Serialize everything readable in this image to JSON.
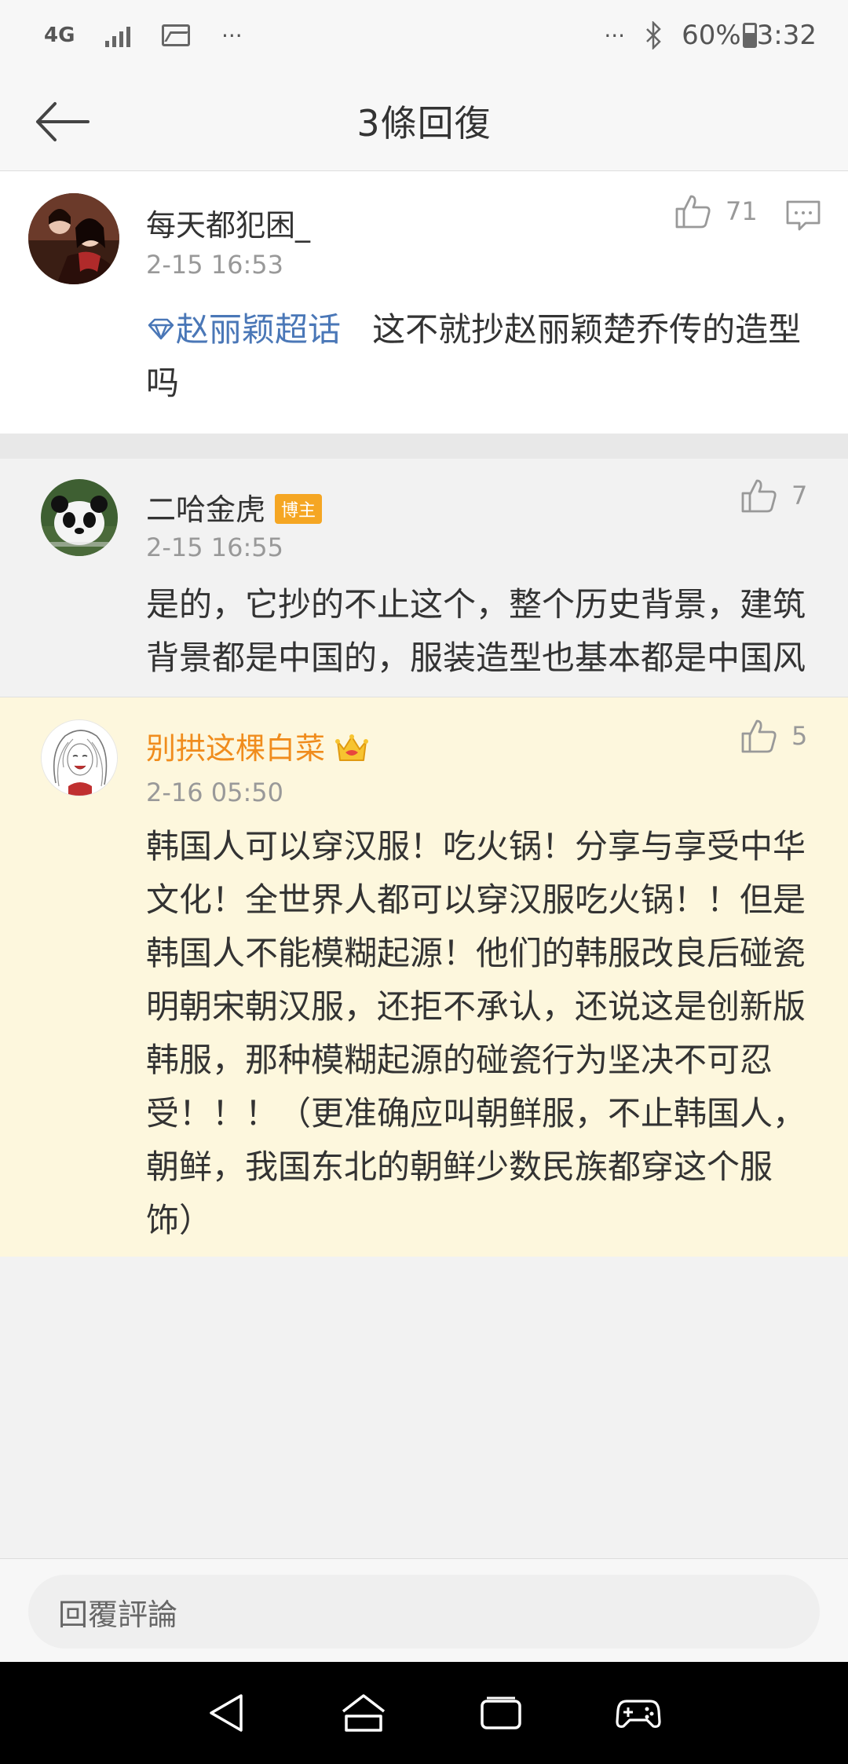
{
  "status_bar": {
    "network": "4G",
    "more_left": "···",
    "more_right": "···",
    "battery": "60%",
    "time": "3:32"
  },
  "header": {
    "title": "3條回復"
  },
  "comments": [
    {
      "username": "每天都犯困_",
      "timestamp": "2-15 16:53",
      "likes": "71",
      "topic": "赵丽颖超话",
      "text": "这不就抄赵丽颖楚乔传的造型吗"
    },
    {
      "username": "二哈金虎",
      "badge": "博主",
      "timestamp": "2-15 16:55",
      "likes": "7",
      "text": "是的，它抄的不止这个，整个历史背景，建筑背景都是中国的，服装造型也基本都是中国风"
    },
    {
      "username": "别拱这棵白菜",
      "timestamp": "2-16 05:50",
      "likes": "5",
      "text": "韩国人可以穿汉服！吃火锅！分享与享受中华文化！全世界人都可以穿汉服吃火锅！！但是韩国人不能模糊起源！他们的韩服改良后碰瓷明朝宋朝汉服，还拒不承认，还说这是创新版韩服，那种模糊起源的碰瓷行为坚决不可忍受！！！（更准确应叫朝鲜服，不止韩国人，朝鲜，我国东北的朝鲜少数民族都穿这个服饰）"
    }
  ],
  "reply_input": {
    "placeholder": "回覆評論"
  },
  "colors": {
    "link": "#4a77b7",
    "highlight_bg": "#fdf7dd",
    "vip_name": "#f08c1d",
    "badge": "#f5a623"
  },
  "icons": [
    "back-arrow-icon",
    "thumbs-up-icon",
    "comment-icon",
    "topic-diamond-icon",
    "crown-icon",
    "nav-back-icon",
    "nav-home-icon",
    "nav-recents-icon",
    "gamepad-icon"
  ]
}
